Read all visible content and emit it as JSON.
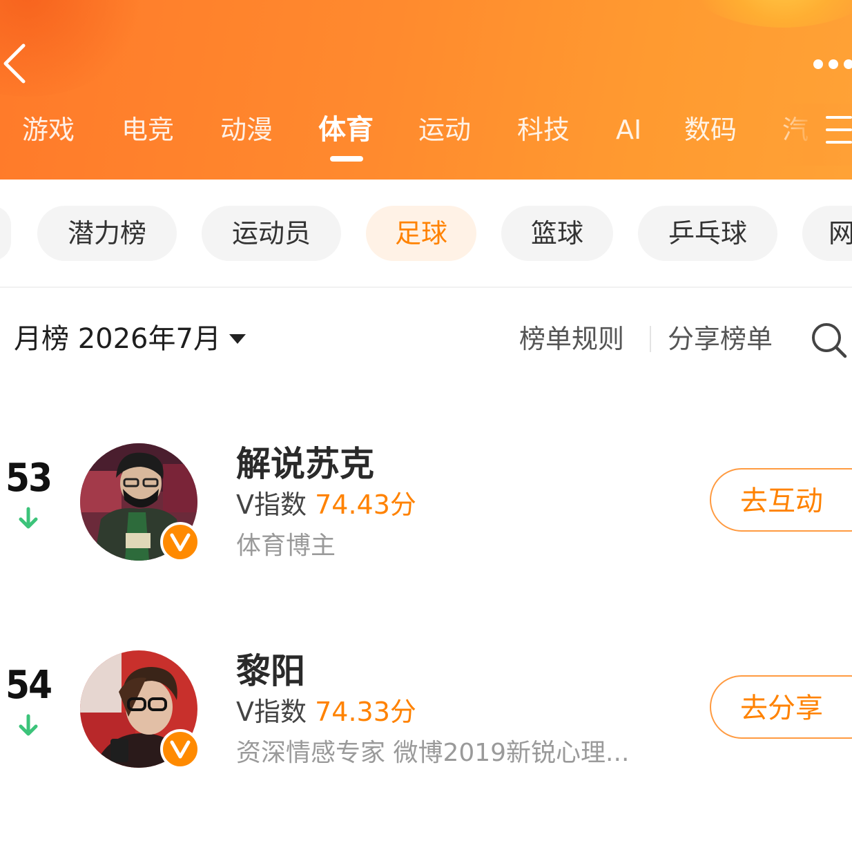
{
  "colors": {
    "accent": "#ff8200",
    "header_start": "#ff7a2a",
    "header_end": "#ffa236",
    "rank_down": "#3cc37a"
  },
  "header": {
    "back_icon": "chevron-left-icon",
    "more_icon": "more-dots-icon",
    "menu_icon": "hamburger-menu-icon",
    "tabs": [
      {
        "label": "游戏"
      },
      {
        "label": "电竞"
      },
      {
        "label": "动漫"
      },
      {
        "label": "体育",
        "active": true
      },
      {
        "label": "运动"
      },
      {
        "label": "科技"
      },
      {
        "label": "AI"
      },
      {
        "label": "数码"
      },
      {
        "label": "汽"
      }
    ]
  },
  "subcategories": [
    {
      "label": "潜力榜"
    },
    {
      "label": "运动员"
    },
    {
      "label": "足球",
      "active": true
    },
    {
      "label": "篮球"
    },
    {
      "label": "乒乓球"
    },
    {
      "label": "网"
    }
  ],
  "filter": {
    "period_label": "月榜 2026年7月",
    "rules_label": "榜单规则",
    "share_label": "分享榜单",
    "search_icon": "search-icon"
  },
  "rankings": [
    {
      "rank": "53",
      "trend": "down",
      "name": "解说苏克",
      "score_prefix": "V指数",
      "score": "74.43分",
      "description": "体育博主",
      "action": "去互动",
      "verified": true
    },
    {
      "rank": "54",
      "trend": "down",
      "name": "黎阳",
      "score_prefix": "V指数",
      "score": "74.33分",
      "description": "资深情感专家 微博2019新锐心理...",
      "action": "去分享",
      "verified": true
    }
  ]
}
